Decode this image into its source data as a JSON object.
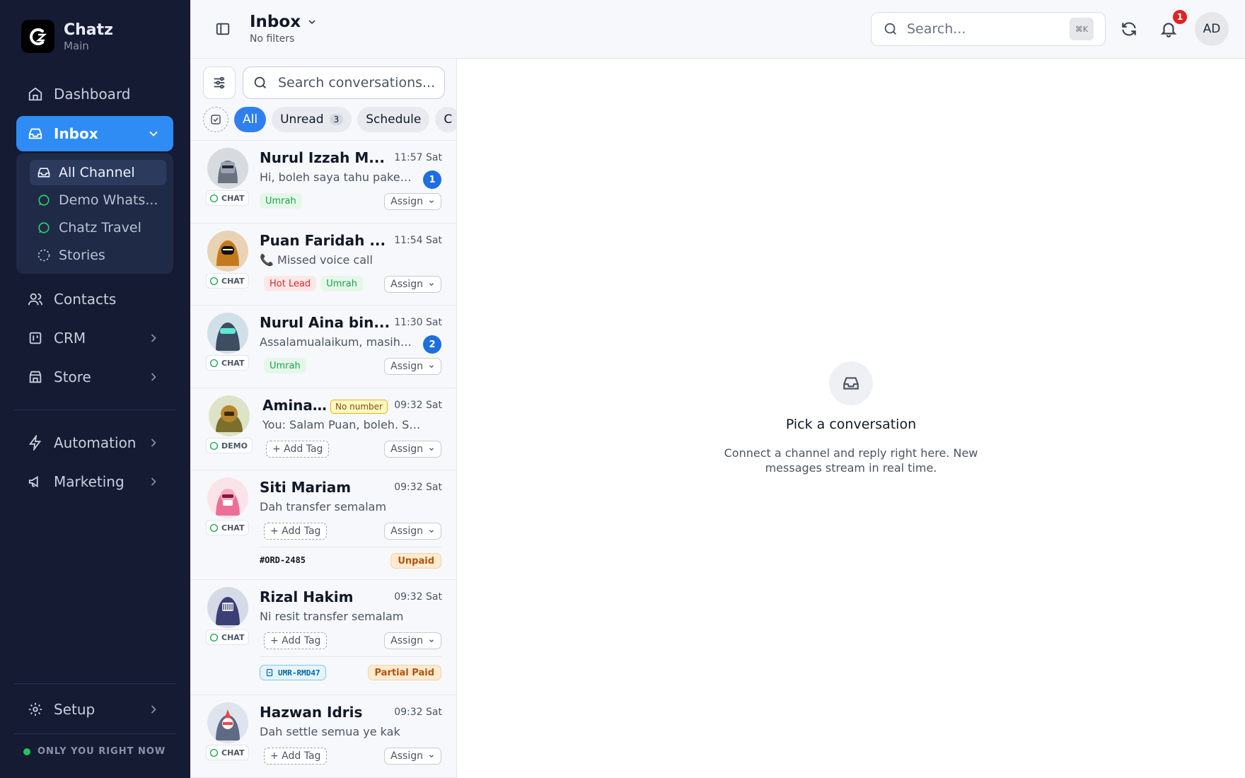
{
  "brand": {
    "name": "Chatz",
    "subtitle": "Main",
    "logo_text": "C"
  },
  "sidebar": {
    "dashboard": "Dashboard",
    "inbox": "Inbox",
    "inbox_items": [
      "All Channel",
      "Demo Whats...",
      "Chatz Travel",
      "Stories"
    ],
    "contacts": "Contacts",
    "crm": "CRM",
    "store": "Store",
    "automation": "Automation",
    "marketing": "Marketing",
    "setup": "Setup",
    "presence": "ONLY YOU RIGHT NOW"
  },
  "header": {
    "title": "Inbox",
    "subtitle": "No filters",
    "search_placeholder": "Search...",
    "search_shortcut": "⌘K",
    "notification_count": "1",
    "user_initials": "AD"
  },
  "list": {
    "search_placeholder": "Search conversations...",
    "chips": {
      "all": "All",
      "unread": "Unread",
      "unread_count": "3",
      "schedule": "Schedule",
      "next": "C"
    },
    "assign_label": "Assign",
    "add_tag_label": "+ Add Tag",
    "conversations": [
      {
        "name": "Nurul Izzah M...",
        "time": "11:57 Sat",
        "preview": "Hi, boleh saya tahu pakej...",
        "unread": "1",
        "channel": "CHAT",
        "tags": [
          "Umrah"
        ]
      },
      {
        "name": "Puan Faridah ...",
        "time": "11:54 Sat",
        "preview": "📞 Missed voice call",
        "channel": "CHAT",
        "tags": [
          "Hot Lead",
          "Umrah"
        ]
      },
      {
        "name": "Nurul Aina bin...",
        "time": "11:30 Sat",
        "preview": "Assalamualaikum, masih ...",
        "unread": "2",
        "channel": "CHAT",
        "tags": [
          "Umrah"
        ]
      },
      {
        "name": "Amina...",
        "time": "09:32 Sat",
        "preview": "You: Salam Puan, boleh. Say...",
        "channel": "DEMO",
        "badge": "No number"
      },
      {
        "name": "Siti Mariam",
        "time": "09:32 Sat",
        "preview": "Dah transfer semalam",
        "channel": "CHAT",
        "order": "#ORD-2485",
        "payment": "Unpaid"
      },
      {
        "name": "Rizal Hakim",
        "time": "09:32 Sat",
        "preview": "Ni resit transfer semalam",
        "channel": "CHAT",
        "order": "UMR-RMD47",
        "payment": "Partial Paid"
      },
      {
        "name": "Hazwan Idris",
        "time": "09:32 Sat",
        "preview": "Dah settle semua ye kak",
        "channel": "CHAT"
      }
    ]
  },
  "detail": {
    "empty_title": "Pick a conversation",
    "empty_text": "Connect a channel and reply right here. New messages stream in real time."
  },
  "colors": {
    "sidebar_bg": "#151b33",
    "accent": "#2f8cf4",
    "unread": "#1d6fe0",
    "whatsapp": "#25d366"
  }
}
